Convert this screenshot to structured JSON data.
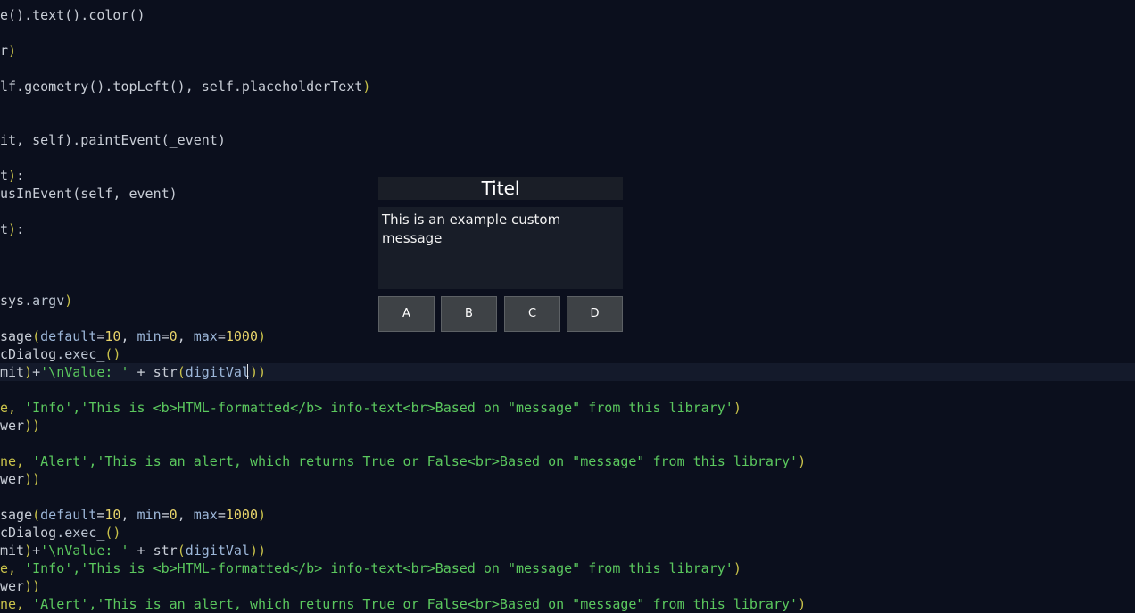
{
  "editor": {
    "lines": [
      [
        {
          "c": "def",
          "t": "e().text().color()"
        }
      ],
      [],
      [
        {
          "c": "def",
          "t": "r"
        },
        {
          "c": "paren",
          "t": ")"
        }
      ],
      [],
      [
        {
          "c": "def",
          "t": "lf.geometry().topLeft(), self.placeholderText"
        },
        {
          "c": "paren",
          "t": ")"
        }
      ],
      [],
      [],
      [
        {
          "c": "def",
          "t": "it, self).paintEvent(_event)"
        }
      ],
      [],
      [
        {
          "c": "def",
          "t": "t"
        },
        {
          "c": "paren",
          "t": ")"
        },
        {
          "c": "def",
          "t": ":"
        }
      ],
      [
        {
          "c": "def",
          "t": "usInEvent(self, event)"
        }
      ],
      [],
      [
        {
          "c": "def",
          "t": "t"
        },
        {
          "c": "paren",
          "t": ")"
        },
        {
          "c": "def",
          "t": ":"
        }
      ],
      [],
      [],
      [],
      [
        {
          "c": "def",
          "t": "sys"
        },
        {
          "c": "attr",
          "t": ".argv"
        },
        {
          "c": "paren",
          "t": ")"
        }
      ],
      [],
      [
        {
          "c": "def",
          "t": "sage"
        },
        {
          "c": "paren",
          "t": "("
        },
        {
          "c": "var",
          "t": "default"
        },
        {
          "c": "def",
          "t": "="
        },
        {
          "c": "num",
          "t": "10"
        },
        {
          "c": "def",
          "t": ", "
        },
        {
          "c": "var",
          "t": "min"
        },
        {
          "c": "def",
          "t": "="
        },
        {
          "c": "num",
          "t": "0"
        },
        {
          "c": "def",
          "t": ", "
        },
        {
          "c": "var",
          "t": "max"
        },
        {
          "c": "def",
          "t": "="
        },
        {
          "c": "num",
          "t": "1000"
        },
        {
          "c": "paren",
          "t": ")"
        }
      ],
      [
        {
          "c": "def",
          "t": "cDialog"
        },
        {
          "c": "attr",
          "t": ".exec_"
        },
        {
          "c": "paren",
          "t": "()"
        }
      ],
      [
        {
          "c": "def",
          "t": "mit"
        },
        {
          "c": "paren",
          "t": ")"
        },
        {
          "c": "def",
          "t": "+"
        },
        {
          "c": "str",
          "t": "'\\nValue: '"
        },
        {
          "c": "def",
          "t": " + str"
        },
        {
          "c": "paren",
          "t": "("
        },
        {
          "c": "var",
          "t": "digitVal"
        },
        {
          "c": "paren",
          "t": "))"
        }
      ],
      [],
      [
        {
          "c": "paren",
          "t": "e, "
        },
        {
          "c": "str",
          "t": "'Info','This is <b>HTML-formatted</b> info-text<br>Based on \"message\" from this library'"
        },
        {
          "c": "paren",
          "t": ")"
        }
      ],
      [
        {
          "c": "def",
          "t": "wer"
        },
        {
          "c": "paren",
          "t": "))"
        }
      ],
      [],
      [
        {
          "c": "paren",
          "t": "ne, "
        },
        {
          "c": "str",
          "t": "'Alert','This is an alert, which returns True or False<br>Based on \"message\" from this library'"
        },
        {
          "c": "paren",
          "t": ")"
        }
      ],
      [
        {
          "c": "def",
          "t": "wer"
        },
        {
          "c": "paren",
          "t": "))"
        }
      ],
      [],
      [
        {
          "c": "def",
          "t": "sage"
        },
        {
          "c": "paren",
          "t": "("
        },
        {
          "c": "var",
          "t": "default"
        },
        {
          "c": "def",
          "t": "="
        },
        {
          "c": "num",
          "t": "10"
        },
        {
          "c": "def",
          "t": ", "
        },
        {
          "c": "var",
          "t": "min"
        },
        {
          "c": "def",
          "t": "="
        },
        {
          "c": "num",
          "t": "0"
        },
        {
          "c": "def",
          "t": ", "
        },
        {
          "c": "var",
          "t": "max"
        },
        {
          "c": "def",
          "t": "="
        },
        {
          "c": "num",
          "t": "1000"
        },
        {
          "c": "paren",
          "t": ")"
        }
      ],
      [
        {
          "c": "def",
          "t": "cDialog"
        },
        {
          "c": "attr",
          "t": ".exec_"
        },
        {
          "c": "paren",
          "t": "()"
        }
      ],
      [
        {
          "c": "def",
          "t": "mit"
        },
        {
          "c": "paren",
          "t": ")"
        },
        {
          "c": "def",
          "t": "+"
        },
        {
          "c": "str",
          "t": "'\\nValue: '"
        },
        {
          "c": "def",
          "t": " + str"
        },
        {
          "c": "paren",
          "t": "("
        },
        {
          "c": "var",
          "t": "digitVal"
        },
        {
          "c": "paren",
          "t": "))"
        }
      ],
      [
        {
          "c": "paren",
          "t": "e, "
        },
        {
          "c": "str",
          "t": "'Info','This is <b>HTML-formatted</b> info-text<br>Based on \"message\" from this library'"
        },
        {
          "c": "paren",
          "t": ")"
        }
      ],
      [
        {
          "c": "def",
          "t": "wer"
        },
        {
          "c": "paren",
          "t": "))"
        }
      ],
      [
        {
          "c": "paren",
          "t": "ne, "
        },
        {
          "c": "str",
          "t": "'Alert','This is an alert, which returns True or False<br>Based on \"message\" from this library'"
        },
        {
          "c": "paren",
          "t": ")"
        }
      ]
    ],
    "current_line_index": 20
  },
  "dialog": {
    "title": "Titel",
    "message": "This is an example custom message",
    "buttons": [
      "A",
      "B",
      "C",
      "D"
    ]
  }
}
